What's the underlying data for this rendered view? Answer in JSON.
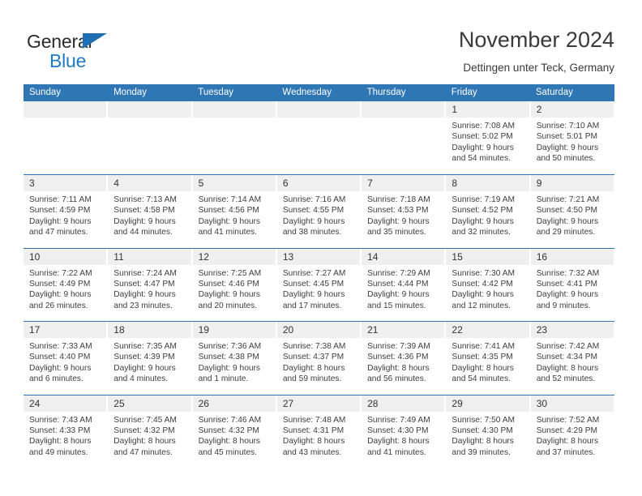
{
  "brand": {
    "name_part1": "General",
    "name_part2": "Blue",
    "triangle_color": "#1f6fb5",
    "blue_color": "#1f7bc1"
  },
  "header": {
    "title": "November 2024",
    "subtitle": "Dettingen unter Teck, Germany"
  },
  "theme": {
    "header_blue": "#2f76b4",
    "day_band_gray": "#efefef",
    "text_color": "#333333"
  },
  "weekdays": [
    "Sunday",
    "Monday",
    "Tuesday",
    "Wednesday",
    "Thursday",
    "Friday",
    "Saturday"
  ],
  "weeks": [
    [
      {
        "day": "",
        "lines": []
      },
      {
        "day": "",
        "lines": []
      },
      {
        "day": "",
        "lines": []
      },
      {
        "day": "",
        "lines": []
      },
      {
        "day": "",
        "lines": []
      },
      {
        "day": "1",
        "lines": [
          "Sunrise: 7:08 AM",
          "Sunset: 5:02 PM",
          "Daylight: 9 hours",
          "and 54 minutes."
        ]
      },
      {
        "day": "2",
        "lines": [
          "Sunrise: 7:10 AM",
          "Sunset: 5:01 PM",
          "Daylight: 9 hours",
          "and 50 minutes."
        ]
      }
    ],
    [
      {
        "day": "3",
        "lines": [
          "Sunrise: 7:11 AM",
          "Sunset: 4:59 PM",
          "Daylight: 9 hours",
          "and 47 minutes."
        ]
      },
      {
        "day": "4",
        "lines": [
          "Sunrise: 7:13 AM",
          "Sunset: 4:58 PM",
          "Daylight: 9 hours",
          "and 44 minutes."
        ]
      },
      {
        "day": "5",
        "lines": [
          "Sunrise: 7:14 AM",
          "Sunset: 4:56 PM",
          "Daylight: 9 hours",
          "and 41 minutes."
        ]
      },
      {
        "day": "6",
        "lines": [
          "Sunrise: 7:16 AM",
          "Sunset: 4:55 PM",
          "Daylight: 9 hours",
          "and 38 minutes."
        ]
      },
      {
        "day": "7",
        "lines": [
          "Sunrise: 7:18 AM",
          "Sunset: 4:53 PM",
          "Daylight: 9 hours",
          "and 35 minutes."
        ]
      },
      {
        "day": "8",
        "lines": [
          "Sunrise: 7:19 AM",
          "Sunset: 4:52 PM",
          "Daylight: 9 hours",
          "and 32 minutes."
        ]
      },
      {
        "day": "9",
        "lines": [
          "Sunrise: 7:21 AM",
          "Sunset: 4:50 PM",
          "Daylight: 9 hours",
          "and 29 minutes."
        ]
      }
    ],
    [
      {
        "day": "10",
        "lines": [
          "Sunrise: 7:22 AM",
          "Sunset: 4:49 PM",
          "Daylight: 9 hours",
          "and 26 minutes."
        ]
      },
      {
        "day": "11",
        "lines": [
          "Sunrise: 7:24 AM",
          "Sunset: 4:47 PM",
          "Daylight: 9 hours",
          "and 23 minutes."
        ]
      },
      {
        "day": "12",
        "lines": [
          "Sunrise: 7:25 AM",
          "Sunset: 4:46 PM",
          "Daylight: 9 hours",
          "and 20 minutes."
        ]
      },
      {
        "day": "13",
        "lines": [
          "Sunrise: 7:27 AM",
          "Sunset: 4:45 PM",
          "Daylight: 9 hours",
          "and 17 minutes."
        ]
      },
      {
        "day": "14",
        "lines": [
          "Sunrise: 7:29 AM",
          "Sunset: 4:44 PM",
          "Daylight: 9 hours",
          "and 15 minutes."
        ]
      },
      {
        "day": "15",
        "lines": [
          "Sunrise: 7:30 AM",
          "Sunset: 4:42 PM",
          "Daylight: 9 hours",
          "and 12 minutes."
        ]
      },
      {
        "day": "16",
        "lines": [
          "Sunrise: 7:32 AM",
          "Sunset: 4:41 PM",
          "Daylight: 9 hours",
          "and 9 minutes."
        ]
      }
    ],
    [
      {
        "day": "17",
        "lines": [
          "Sunrise: 7:33 AM",
          "Sunset: 4:40 PM",
          "Daylight: 9 hours",
          "and 6 minutes."
        ]
      },
      {
        "day": "18",
        "lines": [
          "Sunrise: 7:35 AM",
          "Sunset: 4:39 PM",
          "Daylight: 9 hours",
          "and 4 minutes."
        ]
      },
      {
        "day": "19",
        "lines": [
          "Sunrise: 7:36 AM",
          "Sunset: 4:38 PM",
          "Daylight: 9 hours",
          "and 1 minute."
        ]
      },
      {
        "day": "20",
        "lines": [
          "Sunrise: 7:38 AM",
          "Sunset: 4:37 PM",
          "Daylight: 8 hours",
          "and 59 minutes."
        ]
      },
      {
        "day": "21",
        "lines": [
          "Sunrise: 7:39 AM",
          "Sunset: 4:36 PM",
          "Daylight: 8 hours",
          "and 56 minutes."
        ]
      },
      {
        "day": "22",
        "lines": [
          "Sunrise: 7:41 AM",
          "Sunset: 4:35 PM",
          "Daylight: 8 hours",
          "and 54 minutes."
        ]
      },
      {
        "day": "23",
        "lines": [
          "Sunrise: 7:42 AM",
          "Sunset: 4:34 PM",
          "Daylight: 8 hours",
          "and 52 minutes."
        ]
      }
    ],
    [
      {
        "day": "24",
        "lines": [
          "Sunrise: 7:43 AM",
          "Sunset: 4:33 PM",
          "Daylight: 8 hours",
          "and 49 minutes."
        ]
      },
      {
        "day": "25",
        "lines": [
          "Sunrise: 7:45 AM",
          "Sunset: 4:32 PM",
          "Daylight: 8 hours",
          "and 47 minutes."
        ]
      },
      {
        "day": "26",
        "lines": [
          "Sunrise: 7:46 AM",
          "Sunset: 4:32 PM",
          "Daylight: 8 hours",
          "and 45 minutes."
        ]
      },
      {
        "day": "27",
        "lines": [
          "Sunrise: 7:48 AM",
          "Sunset: 4:31 PM",
          "Daylight: 8 hours",
          "and 43 minutes."
        ]
      },
      {
        "day": "28",
        "lines": [
          "Sunrise: 7:49 AM",
          "Sunset: 4:30 PM",
          "Daylight: 8 hours",
          "and 41 minutes."
        ]
      },
      {
        "day": "29",
        "lines": [
          "Sunrise: 7:50 AM",
          "Sunset: 4:30 PM",
          "Daylight: 8 hours",
          "and 39 minutes."
        ]
      },
      {
        "day": "30",
        "lines": [
          "Sunrise: 7:52 AM",
          "Sunset: 4:29 PM",
          "Daylight: 8 hours",
          "and 37 minutes."
        ]
      }
    ]
  ]
}
